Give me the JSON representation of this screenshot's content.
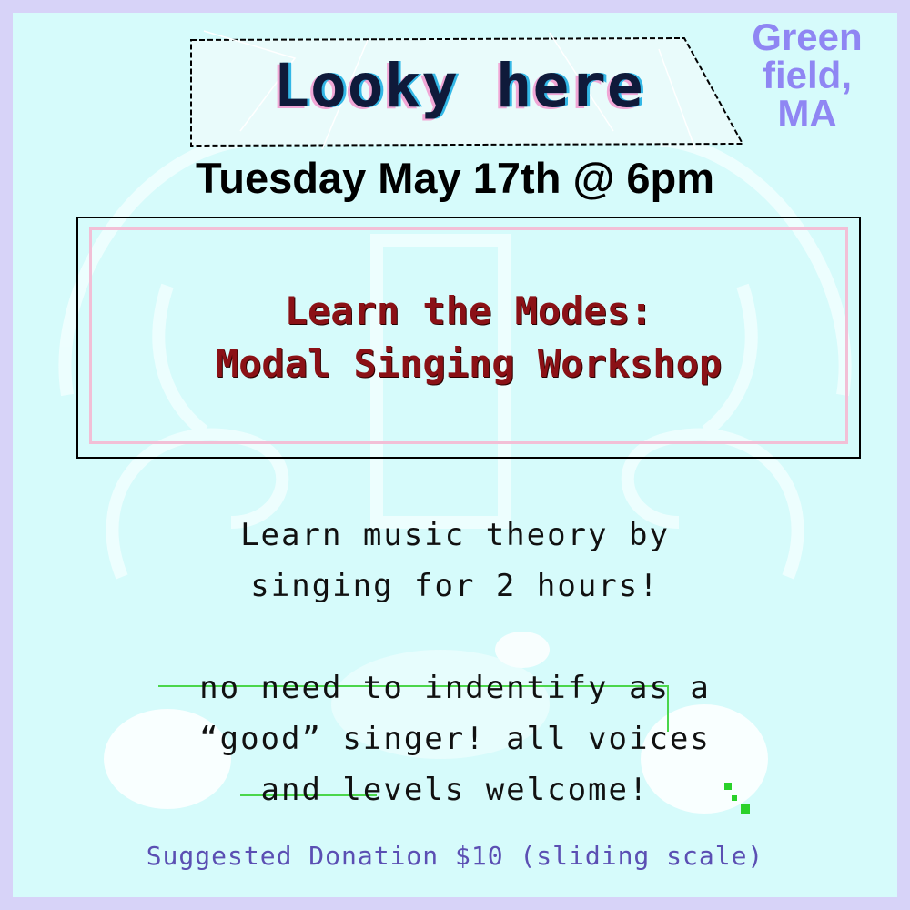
{
  "header": {
    "title": "Looky here",
    "location_lines": [
      "Green",
      "field,",
      "MA"
    ]
  },
  "event": {
    "date": "Tuesday May 17th @ 6pm"
  },
  "workshop": {
    "lines": [
      "Learn the Modes:",
      "Modal Singing Workshop"
    ]
  },
  "description": {
    "paragraph_1": [
      "Learn music theory by",
      "singing for 2 hours!"
    ],
    "paragraph_2": [
      "no need to indentify as a",
      "“good” singer! all voices",
      "and levels welcome!"
    ]
  },
  "footer": {
    "donation": "Suggested Donation $10 (sliding scale)"
  },
  "colors": {
    "frame": "#d7d3f8",
    "background": "#d6fbfb",
    "location": "#8f86f3",
    "workshop_text": "#8b1116",
    "donation_text": "#5b4fb3"
  }
}
